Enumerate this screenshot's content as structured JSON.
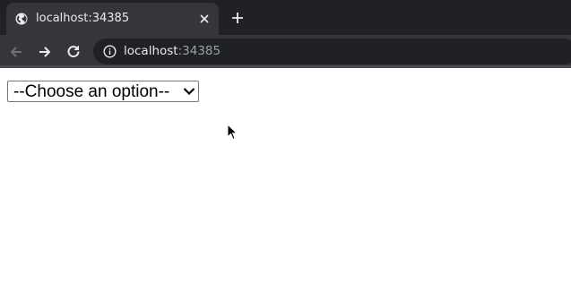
{
  "browser": {
    "tab": {
      "title": "localhost:34385"
    },
    "address": {
      "host": "localhost",
      "port": ":34385"
    }
  },
  "page": {
    "select": {
      "selected_label": "--Choose an option--"
    }
  },
  "colors": {
    "tabbar_bg": "#202124",
    "toolbar_bg": "#35363a",
    "omnibox_bg": "#202124"
  }
}
